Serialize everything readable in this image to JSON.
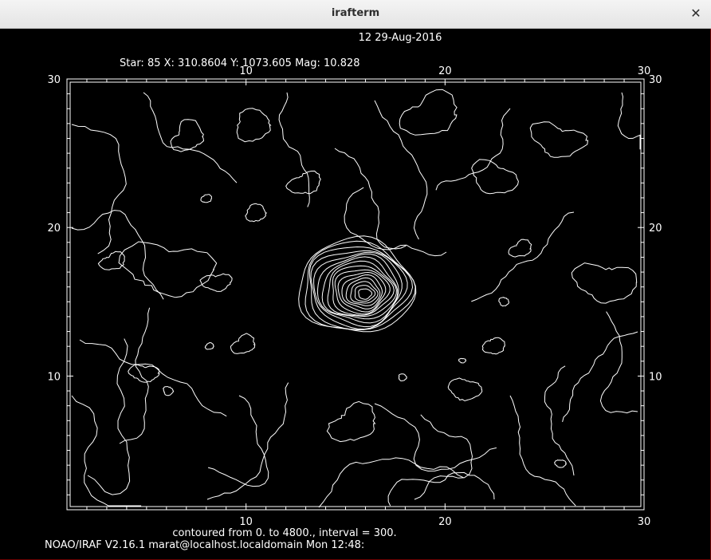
{
  "window": {
    "title": "irafterm",
    "close_glyph": "✕"
  },
  "plot": {
    "header_title": "12 29-Aug-2016",
    "star_line": "Star: 85  X: 310.8604  Y: 1073.605  Mag: 10.828",
    "footer_contour": "contoured from 0. to 4800., interval = 300.",
    "status_line": "NOAO/IRAF V2.16.1 marat@localhost.localdomain Mon 12:48:"
  },
  "chart_data": {
    "type": "contour",
    "title": "12 29-Aug-2016",
    "subtitle": "Star: 85  X: 310.8604  Y: 1073.605  Mag: 10.828",
    "xlabel": "",
    "ylabel": "",
    "xlim": [
      1,
      30
    ],
    "ylim": [
      1,
      30
    ],
    "x_ticks": [
      "10",
      "20",
      "30"
    ],
    "y_ticks": [
      "10",
      "20",
      "30"
    ],
    "contour_range": [
      0,
      4800
    ],
    "contour_interval": 300,
    "peak": {
      "x": 16.0,
      "y": 15.5
    },
    "line_color": "#ffffff",
    "background_color": "#000000"
  }
}
